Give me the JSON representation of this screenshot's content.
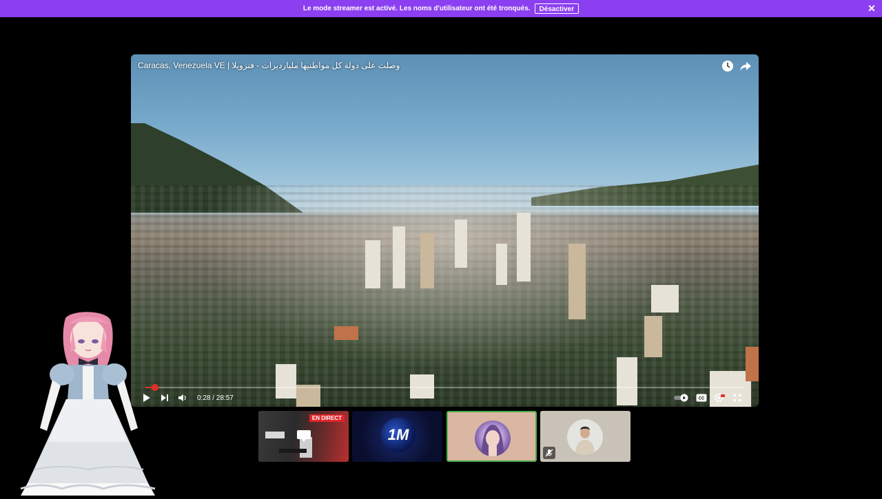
{
  "banner": {
    "message": "Le mode streamer est activé. Les noms d'utilisateur ont été tronqués.",
    "deactivate_label": "Désactiver",
    "close_glyph": "✕",
    "color": "#8b3ff0"
  },
  "video": {
    "title": "وصلت على دولة كل مواطنيها مليارديرات - فنزويلا | Caracas, Venezuela VE",
    "current_time": "0:28",
    "duration": "28:57",
    "time_display": "0:28 / 28:57",
    "progress_fraction": 0.016,
    "accent_color": "#e52d27",
    "top_icons": [
      "clock-icon",
      "share-icon"
    ],
    "control_icons": [
      "play-icon",
      "next-icon",
      "volume-icon",
      "autoplay-toggle-icon",
      "subtitles-icon",
      "settings-icon",
      "fullscreen-exit-icon"
    ]
  },
  "thumbnails": [
    {
      "id": "live-stream",
      "badge": "EN DIRECT"
    },
    {
      "id": "channel-1m",
      "logo_text": "1M"
    },
    {
      "id": "avatar-woman",
      "selected": true
    },
    {
      "id": "avatar-man",
      "muted_icon": "mic-off-icon"
    }
  ]
}
